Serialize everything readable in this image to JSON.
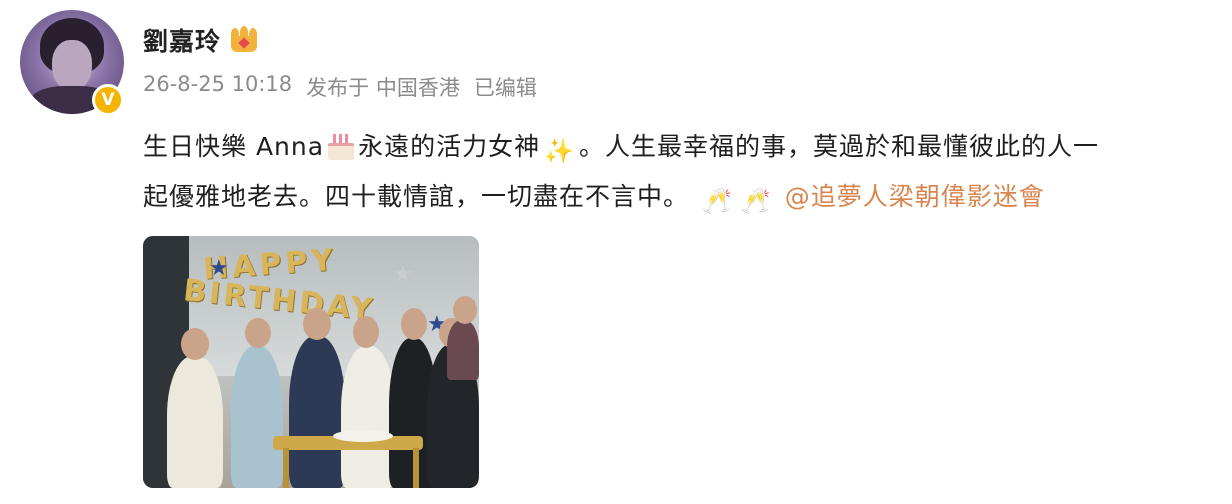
{
  "user": {
    "name": "劉嘉玲",
    "verified_badge": "V",
    "crown_icon": "crown-icon"
  },
  "meta": {
    "timestamp": "26-8-25 10:18",
    "source": "发布于 中国香港",
    "edited": "已编辑"
  },
  "post": {
    "line1_part1": "生日快樂 Anna",
    "line1_part2": "永遠的活力女神",
    "line1_part3": "。人生最幸福的事，莫過於和最懂彼此的人一",
    "line2": "起優雅地老去。四十載情誼，一切盡在不言中。",
    "mention": "@追夢人梁朝偉影迷會"
  },
  "photo": {
    "balloon_line1": "HAPPY",
    "balloon_line2": "BIRTHDAY"
  },
  "colors": {
    "mention": "#d9844c",
    "meta": "#8b8b8b",
    "badge": "#f4b400"
  }
}
